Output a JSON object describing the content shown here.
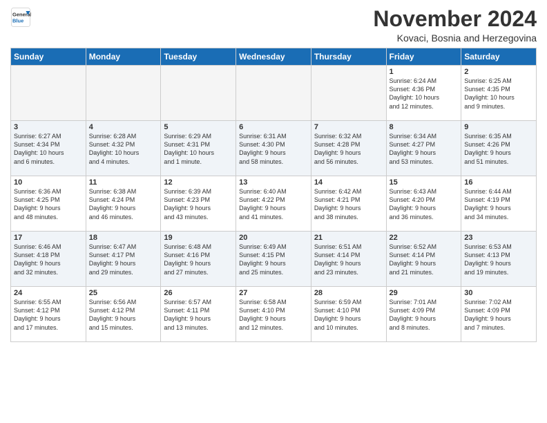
{
  "logo": {
    "general": "General",
    "blue": "Blue"
  },
  "header": {
    "month": "November 2024",
    "location": "Kovaci, Bosnia and Herzegovina"
  },
  "weekdays": [
    "Sunday",
    "Monday",
    "Tuesday",
    "Wednesday",
    "Thursday",
    "Friday",
    "Saturday"
  ],
  "weeks": [
    [
      {
        "day": "",
        "info": ""
      },
      {
        "day": "",
        "info": ""
      },
      {
        "day": "",
        "info": ""
      },
      {
        "day": "",
        "info": ""
      },
      {
        "day": "",
        "info": ""
      },
      {
        "day": "1",
        "info": "Sunrise: 6:24 AM\nSunset: 4:36 PM\nDaylight: 10 hours\nand 12 minutes."
      },
      {
        "day": "2",
        "info": "Sunrise: 6:25 AM\nSunset: 4:35 PM\nDaylight: 10 hours\nand 9 minutes."
      }
    ],
    [
      {
        "day": "3",
        "info": "Sunrise: 6:27 AM\nSunset: 4:34 PM\nDaylight: 10 hours\nand 6 minutes."
      },
      {
        "day": "4",
        "info": "Sunrise: 6:28 AM\nSunset: 4:32 PM\nDaylight: 10 hours\nand 4 minutes."
      },
      {
        "day": "5",
        "info": "Sunrise: 6:29 AM\nSunset: 4:31 PM\nDaylight: 10 hours\nand 1 minute."
      },
      {
        "day": "6",
        "info": "Sunrise: 6:31 AM\nSunset: 4:30 PM\nDaylight: 9 hours\nand 58 minutes."
      },
      {
        "day": "7",
        "info": "Sunrise: 6:32 AM\nSunset: 4:28 PM\nDaylight: 9 hours\nand 56 minutes."
      },
      {
        "day": "8",
        "info": "Sunrise: 6:34 AM\nSunset: 4:27 PM\nDaylight: 9 hours\nand 53 minutes."
      },
      {
        "day": "9",
        "info": "Sunrise: 6:35 AM\nSunset: 4:26 PM\nDaylight: 9 hours\nand 51 minutes."
      }
    ],
    [
      {
        "day": "10",
        "info": "Sunrise: 6:36 AM\nSunset: 4:25 PM\nDaylight: 9 hours\nand 48 minutes."
      },
      {
        "day": "11",
        "info": "Sunrise: 6:38 AM\nSunset: 4:24 PM\nDaylight: 9 hours\nand 46 minutes."
      },
      {
        "day": "12",
        "info": "Sunrise: 6:39 AM\nSunset: 4:23 PM\nDaylight: 9 hours\nand 43 minutes."
      },
      {
        "day": "13",
        "info": "Sunrise: 6:40 AM\nSunset: 4:22 PM\nDaylight: 9 hours\nand 41 minutes."
      },
      {
        "day": "14",
        "info": "Sunrise: 6:42 AM\nSunset: 4:21 PM\nDaylight: 9 hours\nand 38 minutes."
      },
      {
        "day": "15",
        "info": "Sunrise: 6:43 AM\nSunset: 4:20 PM\nDaylight: 9 hours\nand 36 minutes."
      },
      {
        "day": "16",
        "info": "Sunrise: 6:44 AM\nSunset: 4:19 PM\nDaylight: 9 hours\nand 34 minutes."
      }
    ],
    [
      {
        "day": "17",
        "info": "Sunrise: 6:46 AM\nSunset: 4:18 PM\nDaylight: 9 hours\nand 32 minutes."
      },
      {
        "day": "18",
        "info": "Sunrise: 6:47 AM\nSunset: 4:17 PM\nDaylight: 9 hours\nand 29 minutes."
      },
      {
        "day": "19",
        "info": "Sunrise: 6:48 AM\nSunset: 4:16 PM\nDaylight: 9 hours\nand 27 minutes."
      },
      {
        "day": "20",
        "info": "Sunrise: 6:49 AM\nSunset: 4:15 PM\nDaylight: 9 hours\nand 25 minutes."
      },
      {
        "day": "21",
        "info": "Sunrise: 6:51 AM\nSunset: 4:14 PM\nDaylight: 9 hours\nand 23 minutes."
      },
      {
        "day": "22",
        "info": "Sunrise: 6:52 AM\nSunset: 4:14 PM\nDaylight: 9 hours\nand 21 minutes."
      },
      {
        "day": "23",
        "info": "Sunrise: 6:53 AM\nSunset: 4:13 PM\nDaylight: 9 hours\nand 19 minutes."
      }
    ],
    [
      {
        "day": "24",
        "info": "Sunrise: 6:55 AM\nSunset: 4:12 PM\nDaylight: 9 hours\nand 17 minutes."
      },
      {
        "day": "25",
        "info": "Sunrise: 6:56 AM\nSunset: 4:12 PM\nDaylight: 9 hours\nand 15 minutes."
      },
      {
        "day": "26",
        "info": "Sunrise: 6:57 AM\nSunset: 4:11 PM\nDaylight: 9 hours\nand 13 minutes."
      },
      {
        "day": "27",
        "info": "Sunrise: 6:58 AM\nSunset: 4:10 PM\nDaylight: 9 hours\nand 12 minutes."
      },
      {
        "day": "28",
        "info": "Sunrise: 6:59 AM\nSunset: 4:10 PM\nDaylight: 9 hours\nand 10 minutes."
      },
      {
        "day": "29",
        "info": "Sunrise: 7:01 AM\nSunset: 4:09 PM\nDaylight: 9 hours\nand 8 minutes."
      },
      {
        "day": "30",
        "info": "Sunrise: 7:02 AM\nSunset: 4:09 PM\nDaylight: 9 hours\nand 7 minutes."
      }
    ]
  ]
}
